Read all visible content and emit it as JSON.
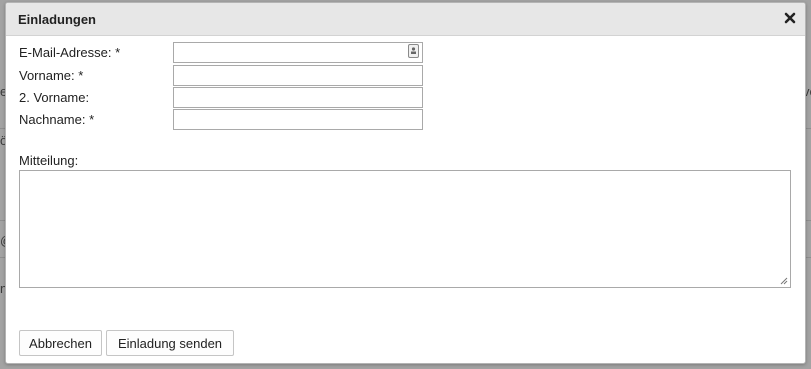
{
  "dialog": {
    "title": "Einladungen",
    "close_icon": "close-icon"
  },
  "background": {
    "left_fragments": [
      "e",
      "ö",
      "@",
      "n"
    ],
    "right_fragments": [
      "ve"
    ]
  },
  "form": {
    "email_label": "E-Mail-Adresse: *",
    "email_value": "",
    "contact_icon": "contact-card-icon",
    "firstname_label": "Vorname: *",
    "firstname_value": "",
    "middlename_label": "2. Vorname:",
    "middlename_value": "",
    "lastname_label": "Nachname: *",
    "lastname_value": "",
    "message_label": "Mitteilung:",
    "message_value": ""
  },
  "buttons": {
    "cancel_label": "Abbrechen",
    "send_label": "Einladung senden"
  }
}
